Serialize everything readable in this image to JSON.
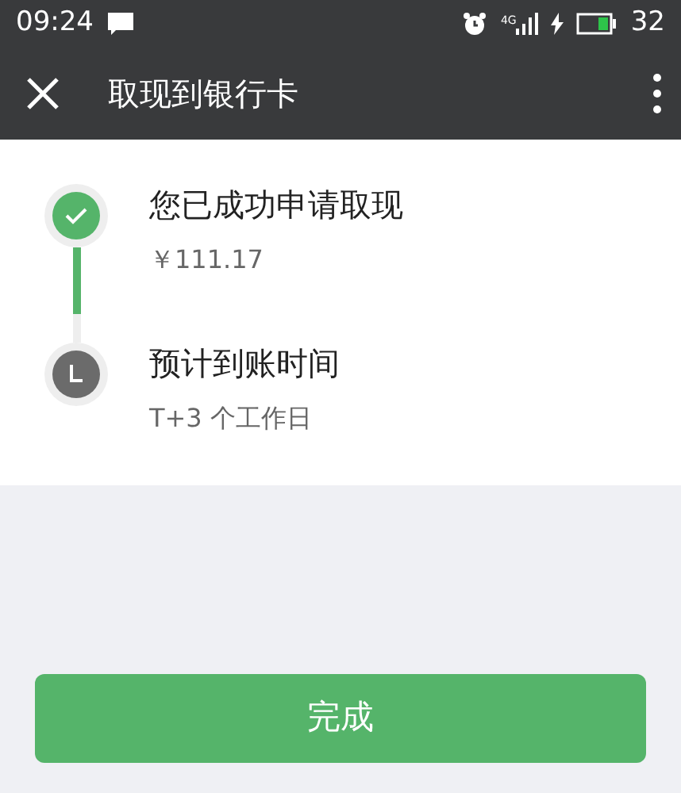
{
  "status_bar": {
    "time": "09:24",
    "network": "4G",
    "battery": "32"
  },
  "header": {
    "title": "取现到银行卡"
  },
  "steps": [
    {
      "kind": "done",
      "title": "您已成功申请取现",
      "detail": "￥111.17"
    },
    {
      "kind": "pending",
      "title": "预计到账时间",
      "detail": "T+3 个工作日"
    }
  ],
  "button": {
    "label": "完成"
  }
}
